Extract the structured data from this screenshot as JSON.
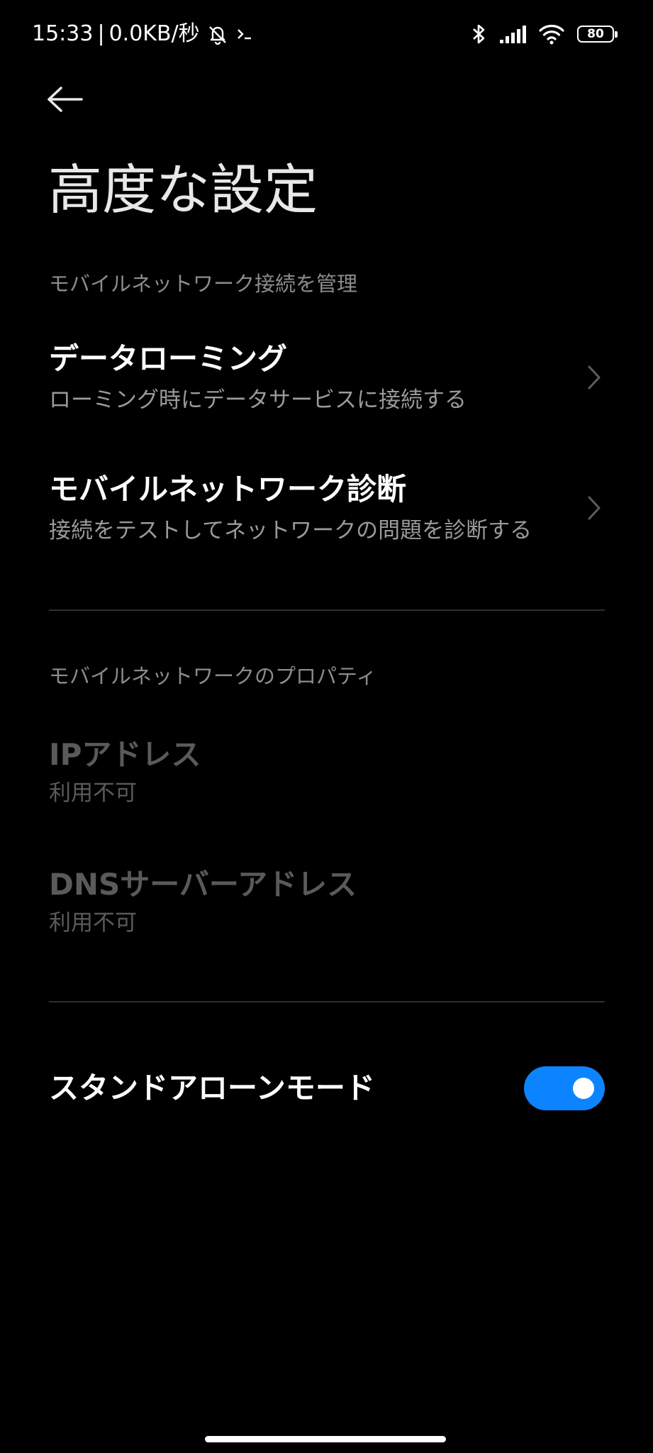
{
  "status_bar": {
    "time": "15:33",
    "separator": "|",
    "net_speed": "0.0KB/秒",
    "battery_level": "80"
  },
  "header": {
    "title": "高度な設定"
  },
  "section_manage": {
    "header": "モバイルネットワーク接続を管理",
    "items": [
      {
        "title": "データローミング",
        "subtitle": "ローミング時にデータサービスに接続する"
      },
      {
        "title": "モバイルネットワーク診断",
        "subtitle": "接続をテストしてネットワークの問題を診断する"
      }
    ]
  },
  "section_properties": {
    "header": "モバイルネットワークのプロパティ",
    "items": [
      {
        "title": "IPアドレス",
        "subtitle": "利用不可"
      },
      {
        "title": "DNSサーバーアドレス",
        "subtitle": "利用不可"
      }
    ]
  },
  "standalone": {
    "label": "スタンドアローンモード",
    "enabled": true
  },
  "colors": {
    "accent": "#0d84ff",
    "background": "#000000"
  }
}
